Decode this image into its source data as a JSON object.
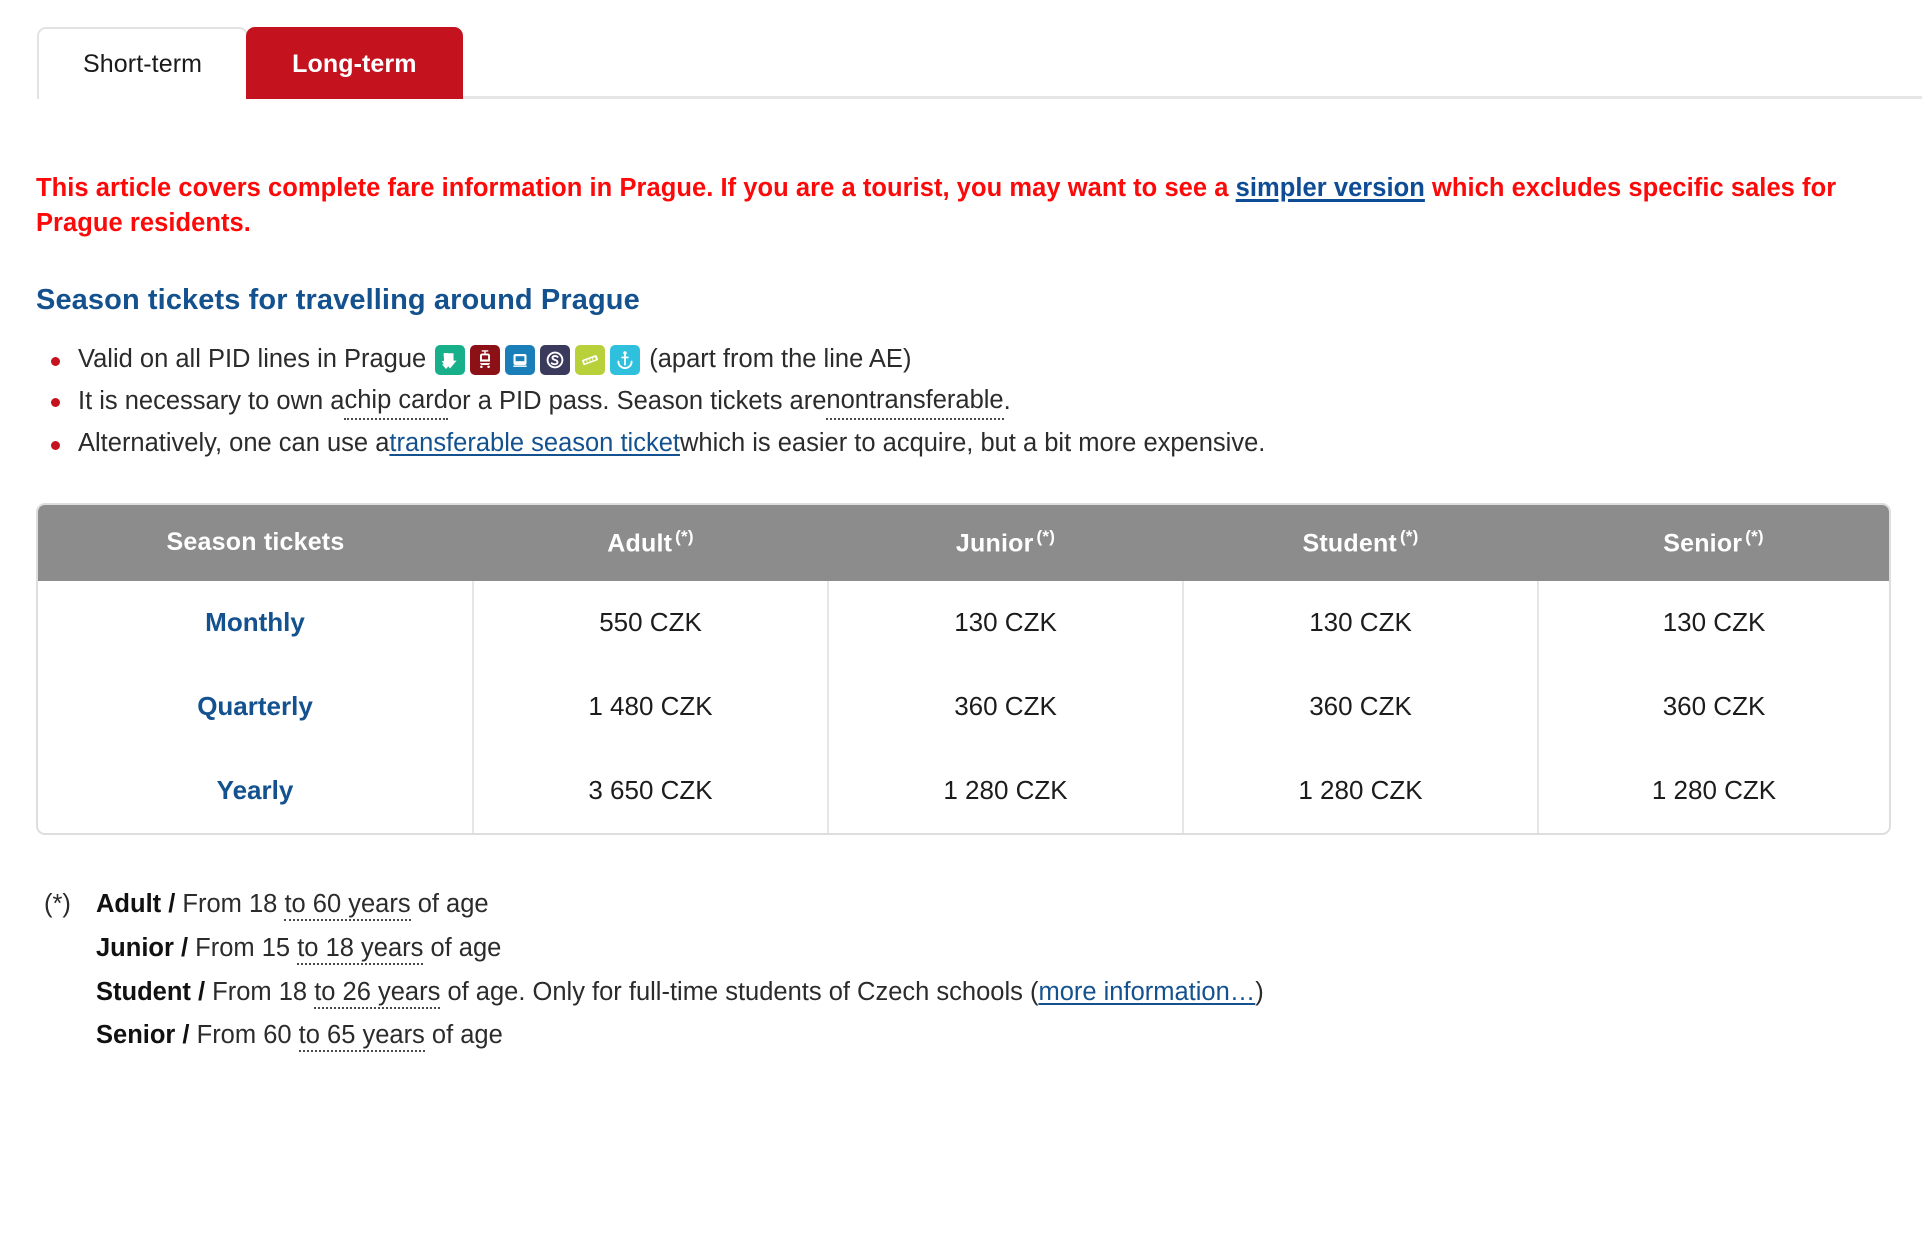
{
  "tabs": [
    {
      "label": "Short-term",
      "active": false
    },
    {
      "label": "Long-term",
      "active": true
    }
  ],
  "notice": {
    "part1": "This article covers complete fare information in Prague. If you are a tourist, you may want to see a ",
    "link": "simpler version",
    "part2": " which excludes specific sales for Prague residents."
  },
  "section": {
    "title": "Season tickets for travelling around Prague"
  },
  "bullets": [
    {
      "pre": "Valid on all PID lines in Prague",
      "post": "(apart from the line AE)",
      "has_modes": true
    },
    {
      "segments": [
        {
          "text": "It is necessary to own a ",
          "style": "plain"
        },
        {
          "text": "chip card",
          "style": "abbr"
        },
        {
          "text": " or a PID pass. Season tickets are ",
          "style": "plain"
        },
        {
          "text": "nontransferable",
          "style": "abbr"
        },
        {
          "text": ".",
          "style": "plain"
        }
      ]
    },
    {
      "segments": [
        {
          "text": "Alternatively, one can use a ",
          "style": "plain"
        },
        {
          "text": "transferable season ticket",
          "style": "link"
        },
        {
          "text": " which is easier to acquire, but a bit more expensive.",
          "style": "plain"
        }
      ]
    }
  ],
  "modes": [
    {
      "name": "metro-icon",
      "color": "#17b08a",
      "glyph": "metro"
    },
    {
      "name": "tram-icon",
      "color": "#8c1116",
      "glyph": "tram"
    },
    {
      "name": "bus-icon",
      "color": "#1a7fb8",
      "glyph": "bus"
    },
    {
      "name": "train-icon",
      "color": "#3a3a5c",
      "glyph": "train"
    },
    {
      "name": "funicular-icon",
      "color": "#b8d13a",
      "glyph": "funicular"
    },
    {
      "name": "ferry-icon",
      "color": "#2fc0dd",
      "glyph": "ferry"
    }
  ],
  "table": {
    "headers": [
      {
        "label": "Season tickets",
        "star": ""
      },
      {
        "label": "Adult",
        "star": "(*)"
      },
      {
        "label": "Junior",
        "star": "(*)"
      },
      {
        "label": "Student",
        "star": "(*)"
      },
      {
        "label": "Senior",
        "star": "(*)"
      }
    ],
    "rows": [
      {
        "label": "Monthly",
        "cells": [
          "550 CZK",
          "130 CZK",
          "130 CZK",
          "130 CZK"
        ]
      },
      {
        "label": "Quarterly",
        "cells": [
          "1 480 CZK",
          "360 CZK",
          "360 CZK",
          "360 CZK"
        ]
      },
      {
        "label": "Yearly",
        "cells": [
          "3 650 CZK",
          "1 280 CZK",
          "1 280 CZK",
          "1 280 CZK"
        ]
      }
    ]
  },
  "footnotes": {
    "star": "(*)",
    "rows": [
      {
        "term": "Adult /",
        "pre": " From 18 ",
        "abbr": "to 60 years",
        "post": " of age",
        "link": "",
        "tail": ""
      },
      {
        "term": "Junior /",
        "pre": " From 15 ",
        "abbr": "to 18 years",
        "post": " of age",
        "link": "",
        "tail": ""
      },
      {
        "term": "Student /",
        "pre": " From 18 ",
        "abbr": "to 26 years",
        "post": " of age. Only for full-time students of Czech schools (",
        "link": "more information…",
        "tail": ")"
      },
      {
        "term": "Senior /",
        "pre": " From 60 ",
        "abbr": "to 65 years",
        "post": " of age",
        "link": "",
        "tail": ""
      }
    ]
  },
  "colors": {
    "accent_red": "#c4121f",
    "notice_red": "#fc0a0a",
    "link_blue": "#13518f",
    "header_gray": "#8c8c8c"
  }
}
